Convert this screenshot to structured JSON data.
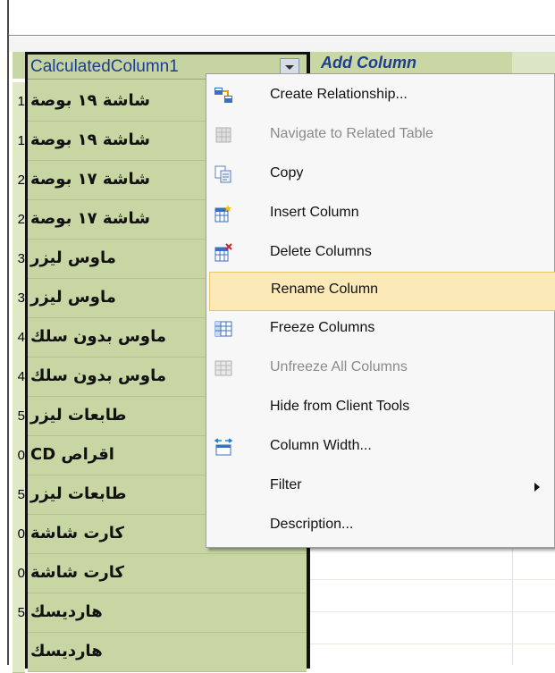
{
  "column": {
    "header_label": "CalculatedColumn1",
    "add_column_label": "Add Column",
    "cells": [
      "شاشة ١٩ بوصة",
      "شاشة ١٩ بوصة",
      "شاشة ١٧ بوصة",
      "شاشة ١٧ بوصة",
      "ماوس ليزر",
      "ماوس ليزر",
      "ماوس بدون سلك",
      "ماوس بدون سلك",
      "طابعات ليزر",
      "CD اقراص",
      "طابعات ليزر",
      "كارت شاشة",
      "كارت شاشة",
      "هارديسك",
      "هارديسك"
    ],
    "row_numbers": [
      "1",
      "1",
      "2",
      "2",
      "3",
      "3",
      "4",
      "4",
      "5",
      "0",
      "5",
      "0",
      "0",
      "5",
      ""
    ]
  },
  "context_menu": {
    "items": [
      {
        "label": "Create Relationship...",
        "icon": "create-relationship-icon",
        "enabled": true
      },
      {
        "label": "Navigate to Related Table",
        "icon": "navigate-table-icon",
        "enabled": false
      },
      {
        "label": "Copy",
        "icon": "copy-icon",
        "enabled": true
      },
      {
        "label": "Insert Column",
        "icon": "insert-column-icon",
        "enabled": true
      },
      {
        "label": "Delete Columns",
        "icon": "delete-columns-icon",
        "enabled": true
      },
      {
        "label": "Rename Column",
        "icon": "",
        "enabled": true,
        "highlighted": true
      },
      {
        "label": "Freeze Columns",
        "icon": "freeze-columns-icon",
        "enabled": true
      },
      {
        "label": "Unfreeze All Columns",
        "icon": "unfreeze-columns-icon",
        "enabled": false
      },
      {
        "label": "Hide from Client Tools",
        "icon": "",
        "enabled": true
      },
      {
        "label": "Column Width...",
        "icon": "column-width-icon",
        "enabled": true
      },
      {
        "label": "Filter",
        "icon": "",
        "enabled": true,
        "submenu": true
      },
      {
        "label": "Description...",
        "icon": "",
        "enabled": true
      }
    ]
  },
  "colors": {
    "cell_bg": "#c8d6a3",
    "header_text": "#1d3d8f",
    "highlight": "#fbe9b7"
  }
}
